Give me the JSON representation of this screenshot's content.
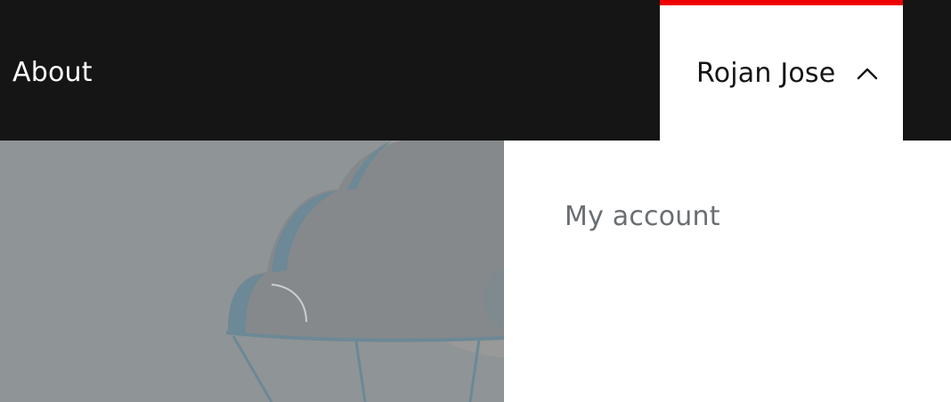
{
  "navbar": {
    "about_label": "About",
    "user_menu": {
      "name": "Rojan Jose",
      "icon": "chevron-up-icon",
      "expanded": true
    }
  },
  "dropdown": {
    "items": [
      {
        "label": "My account"
      }
    ]
  },
  "hero": {
    "illustration": "cloud-balloon-illustration"
  },
  "colors": {
    "navbar_bg": "#151515",
    "accent": "#ee0000",
    "menu_text": "#6a6e73",
    "hero_bg": "#8f9496"
  }
}
